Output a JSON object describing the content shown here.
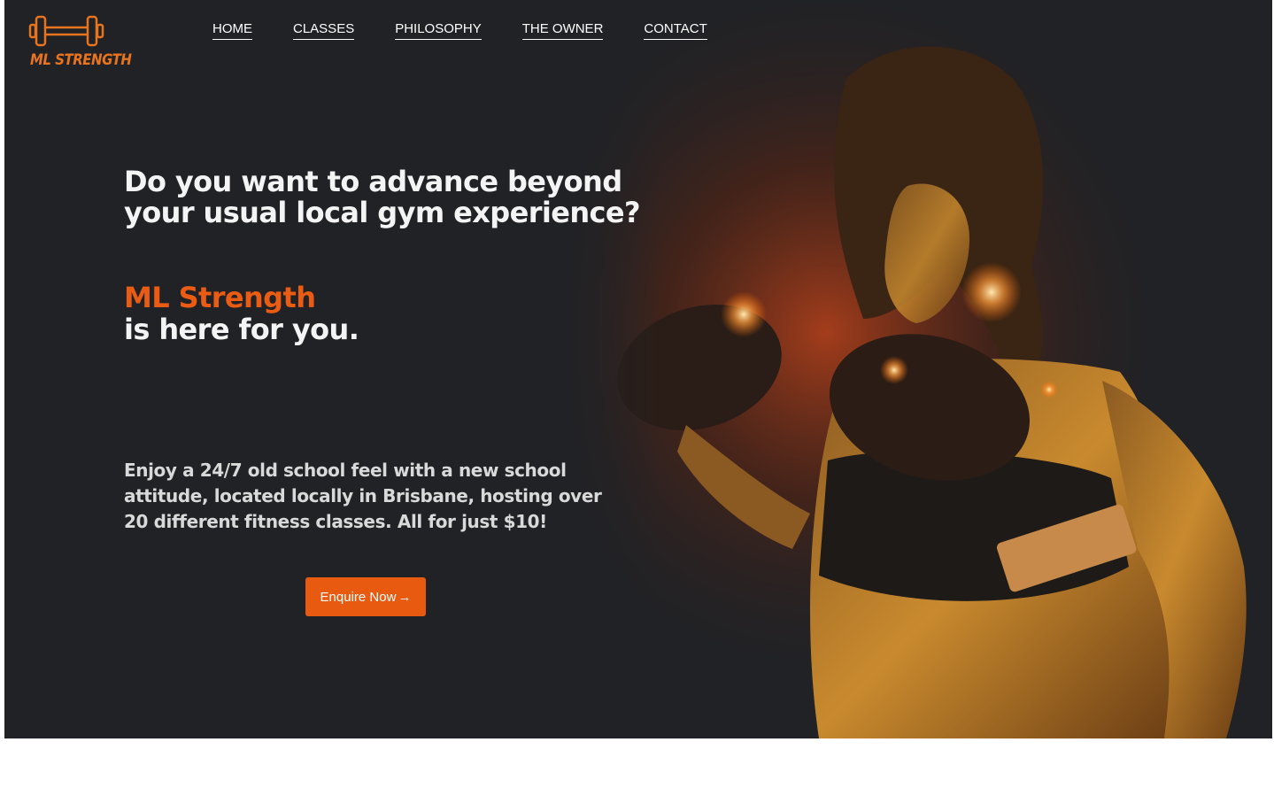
{
  "brand": {
    "name": "ML STRENGTH",
    "logo_icon": "dumbbell-icon",
    "accent_color": "#ea5b13"
  },
  "nav": {
    "items": [
      {
        "label": "HOME"
      },
      {
        "label": "CLASSES"
      },
      {
        "label": "PHILOSOPHY"
      },
      {
        "label": "THE OWNER"
      },
      {
        "label": "CONTACT"
      }
    ]
  },
  "hero": {
    "headline": "Do you want to advance beyond your usual local gym experience?",
    "brand_line": "ML Strength",
    "tagline": "is here for you.",
    "description": "Enjoy a 24/7 old school feel with a new school attitude, located locally in Brisbane, hosting over 20 different fitness classes. All for just $10!",
    "cta_label": "Enquire Now",
    "cta_arrow": "→",
    "background_color": "#202226"
  }
}
